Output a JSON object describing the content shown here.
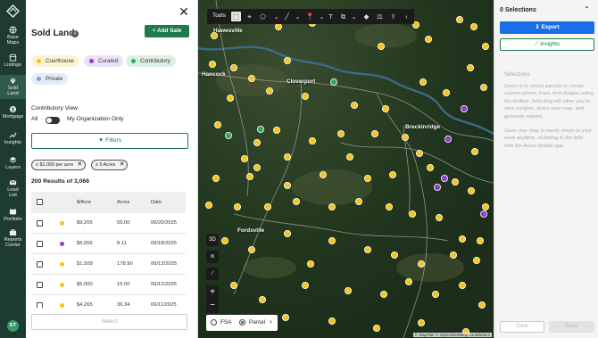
{
  "nav": {
    "items": [
      {
        "label1": "Base",
        "label2": "Maps"
      },
      {
        "label1": "Listings",
        "label2": ""
      },
      {
        "label1": "Sold",
        "label2": "Land"
      },
      {
        "label1": "Mortgage",
        "label2": ""
      },
      {
        "label1": "Insights",
        "label2": ""
      },
      {
        "label1": "Layers",
        "label2": ""
      },
      {
        "label1": "Lead",
        "label2": "List"
      },
      {
        "label1": "Portfolio",
        "label2": ""
      },
      {
        "label1": "Reports",
        "label2": "Center"
      }
    ],
    "avatar": "ET"
  },
  "panel": {
    "title": "Sold Land",
    "add_sale": "+ Add Sale",
    "chips": [
      "Courthouse",
      "Curated",
      "Contributory",
      "Private"
    ],
    "contributory_view": "Contributory View",
    "toggle_all": "All",
    "toggle_org": "My Organization Only",
    "filters": "Filters",
    "filter_chips": [
      "≥ $1,000 per acre",
      "≥ 5 Acres"
    ],
    "results": "200 Results of 3,066",
    "columns": [
      "$/Acre",
      "Acres",
      "Date"
    ],
    "rows": [
      {
        "price": "$9,205",
        "acres": "55.00",
        "date": "06/20/2025"
      },
      {
        "price": "$5,055",
        "acres": "8.11",
        "date": "06/18/2025"
      },
      {
        "price": "$1,509",
        "acres": "178.90",
        "date": "06/13/2025"
      },
      {
        "price": "$5,000",
        "acres": "15.00",
        "date": "06/12/2025"
      },
      {
        "price": "$4,265",
        "acres": "36.34",
        "date": "06/11/2025"
      }
    ],
    "select": "Select"
  },
  "map": {
    "tools_label": "Tools",
    "ctl_3d": "3D",
    "zoom_in": "+",
    "zoom_out": "−",
    "layer_fsa": "FSA",
    "layer_parcel": "Parcel",
    "attribution": "© MapTiler © OpenStreetMap contributors",
    "places": [
      "Hawesville",
      "Cloverport",
      "Hancock",
      "Breckinridge",
      "Fordsville"
    ]
  },
  "right": {
    "title": "0 Selections",
    "export": "Export",
    "insights": "Insights",
    "selections_title": "Selections",
    "selections_body": "Zoom in to select parcels or create custom points, lines, and shapes using the toolbar. Selecting will allow you to view insights, share your map, and generate reports.",
    "selections_body2": "Save your map to easily return to your work anytime, including in the field with the Acres Mobile app.",
    "clear": "Clear",
    "save": "Save"
  },
  "colors": {
    "courthouse": "#f5c518",
    "curated": "#8a3fd1",
    "contributory": "#35a85f",
    "private": "#7aa0d6",
    "brand": "#1f7a4d",
    "export": "#1a6ee6"
  }
}
